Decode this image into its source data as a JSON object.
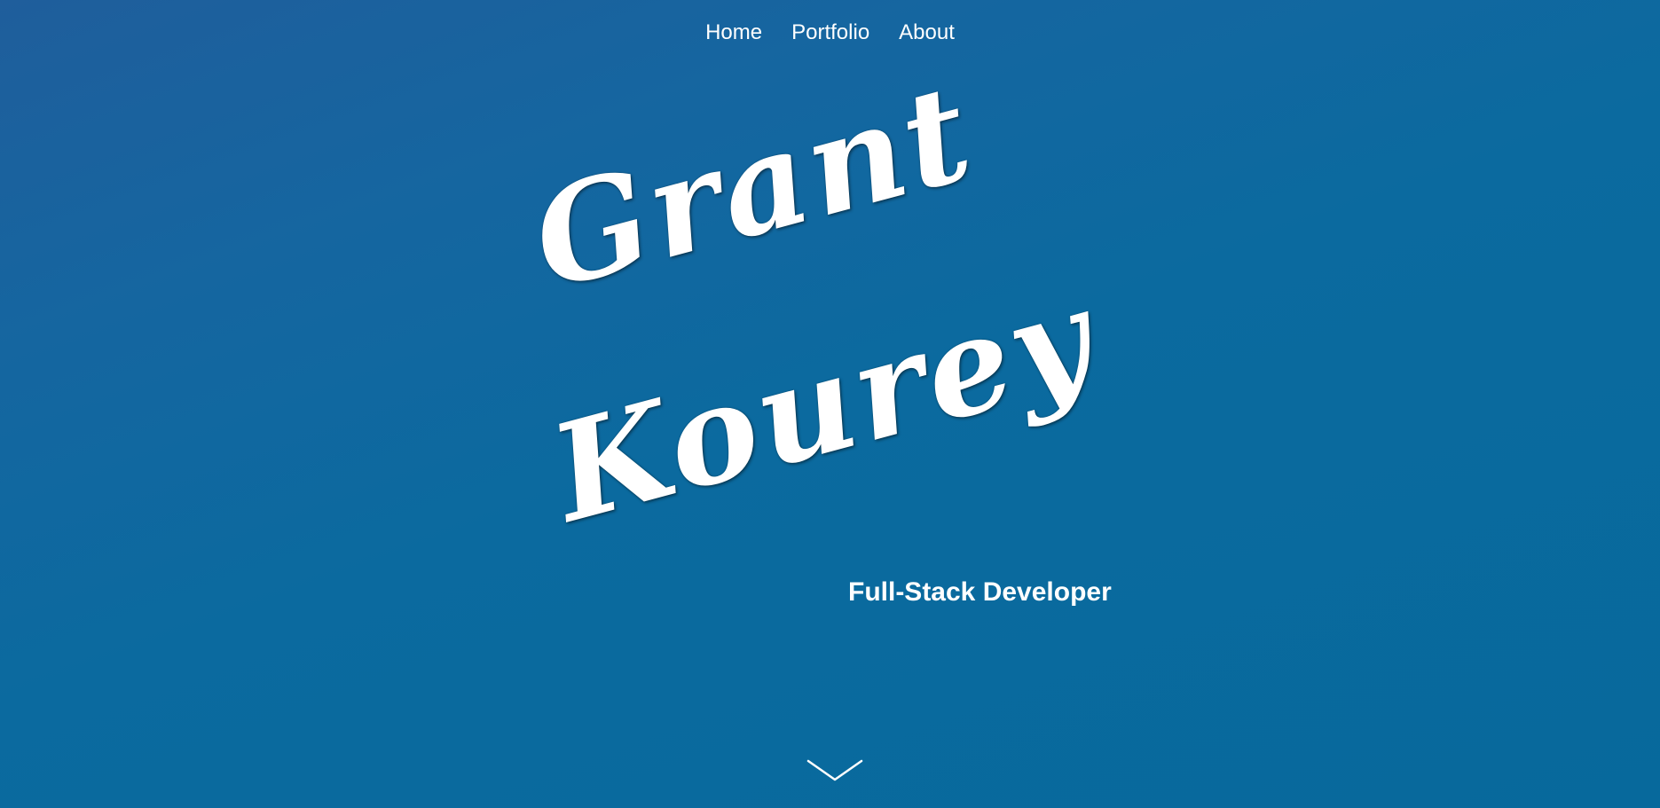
{
  "nav": {
    "items": [
      {
        "label": "Home"
      },
      {
        "label": "Portfolio"
      },
      {
        "label": "About"
      }
    ]
  },
  "hero": {
    "first_name": "Grant",
    "last_name": "Kourey",
    "subtitle": "Full-Stack Developer",
    "scroll_icon": "chevron-down-icon"
  },
  "colors": {
    "background_start": "#1f5e9c",
    "background_end": "#07699c",
    "text": "#ffffff"
  }
}
